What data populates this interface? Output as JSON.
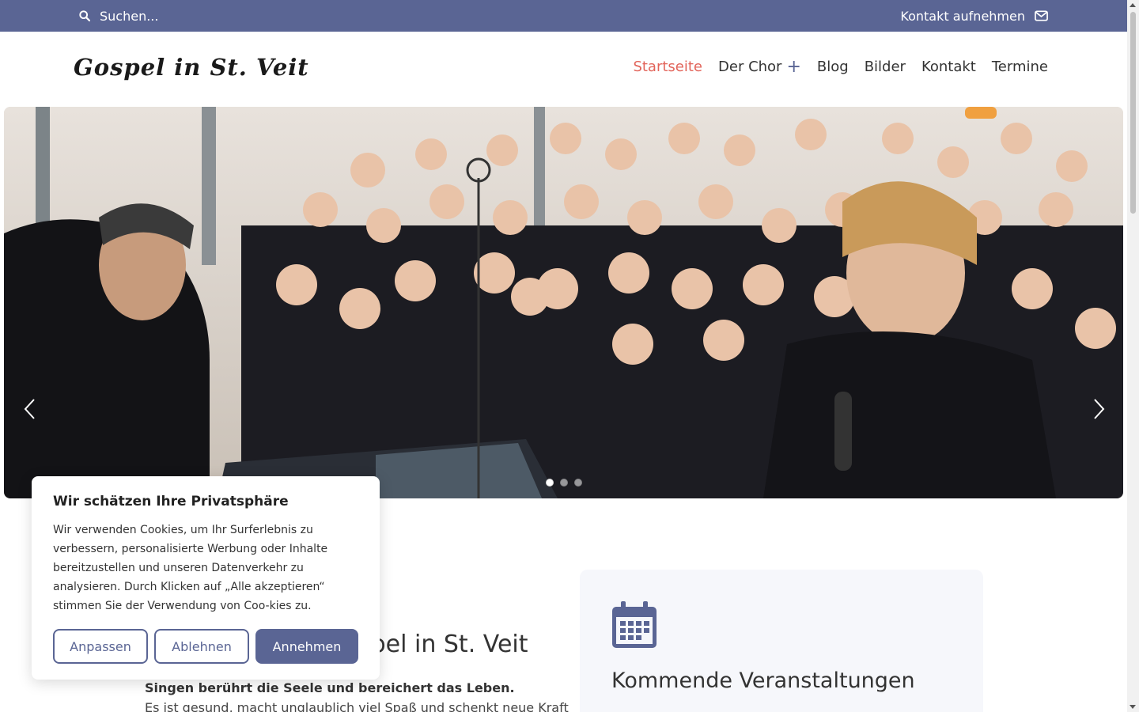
{
  "topbar": {
    "search_placeholder": "Suchen...",
    "contact_label": "Kontakt aufnehmen",
    "bg_color": "#5a6594"
  },
  "header": {
    "logo": "Gospel in St. Veit",
    "nav": [
      {
        "label": "Startseite",
        "active": true
      },
      {
        "label": "Der Chor",
        "has_submenu": true
      },
      {
        "label": "Blog"
      },
      {
        "label": "Bilder"
      },
      {
        "label": "Kontakt"
      },
      {
        "label": "Termine"
      }
    ],
    "active_color": "#e2645a"
  },
  "hero": {
    "slide_count": 3,
    "active_slide": 1
  },
  "content": {
    "title_visible": "spel in St. Veit",
    "lead": "Singen berührt die Seele und bereichert das Leben.",
    "body_partial": "Es ist gesund, macht unglaublich viel Spaß und schenkt neue Kraft"
  },
  "events": {
    "icon": "calendar-icon",
    "title": "Kommende Veranstaltungen"
  },
  "cookie": {
    "title": "Wir schätzen Ihre Privatsphäre",
    "text": "Wir verwenden Cookies, um Ihr Surferlebnis zu verbessern, personalisierte Werbung oder Inhalte bereitzustellen und unseren Datenverkehr zu analysieren. Durch Klicken auf „Alle akzeptieren“ stimmen Sie der Verwendung von Coo-kies zu.",
    "btn_customize": "Anpassen",
    "btn_reject": "Ablehnen",
    "btn_accept": "Annehmen"
  }
}
